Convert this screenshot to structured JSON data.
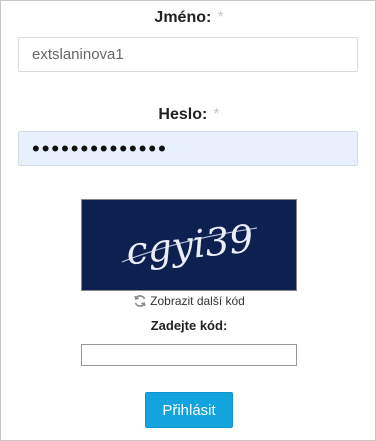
{
  "form": {
    "username_label": "Jméno:",
    "username_required_mark": "*",
    "username_value": "extslaninova1",
    "password_label": "Heslo:",
    "password_required_mark": "*",
    "password_value": "••••••••••••••",
    "captcha_text": "cgyi39",
    "refresh_label": "Zobrazit další kód",
    "refresh_icon": "refresh-icon",
    "code_label": "Zadejte kód:",
    "code_value": "",
    "submit_label": "Přihlásit"
  },
  "colors": {
    "captcha_background": "#0d2150",
    "captcha_text": "#e9eef8",
    "submit_background": "#13a3dd",
    "password_autofill": "#e8f0fe",
    "required_mark": "#c8c8c8"
  }
}
